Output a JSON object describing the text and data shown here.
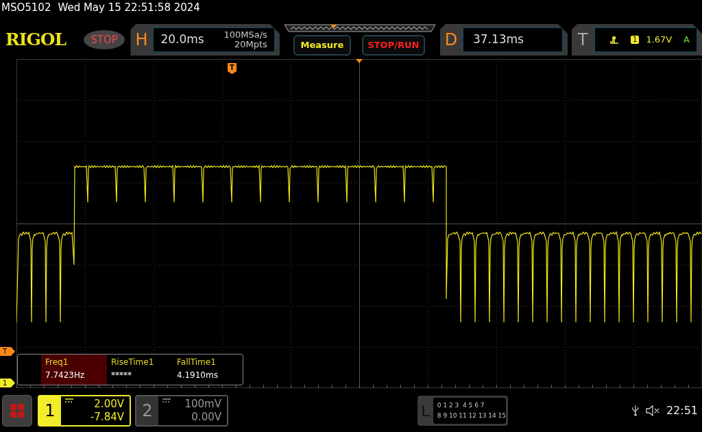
{
  "title_bar": {
    "model": "MSO5102",
    "datetime": "Wed May 15 22:51:58 2024"
  },
  "header": {
    "logo": "RIGOL",
    "run_state": "STOP",
    "horizontal": {
      "letter": "H",
      "timebase": "20.0ms",
      "sample_rate": "100MSa/s",
      "memory_depth": "20Mpts"
    },
    "menu_buttons": [
      {
        "label": "Measure",
        "kind": "menu"
      },
      {
        "label": "STOP/RUN",
        "kind": "run"
      }
    ],
    "delay": {
      "letter": "D",
      "value": "37.13ms"
    },
    "trigger": {
      "letter": "T",
      "source": "1",
      "level": "1.67V",
      "mode": "A"
    }
  },
  "graticule": {
    "top_marker": "T",
    "side_markers": [
      {
        "label": "T",
        "kind": "trigger"
      },
      {
        "label": "1",
        "kind": "channel"
      }
    ]
  },
  "measurements": [
    {
      "name": "Freq1",
      "value": "7.7423Hz",
      "selected": true
    },
    {
      "name": "RiseTime1",
      "value": "*****",
      "selected": false
    },
    {
      "name": "FallTime1",
      "value": "4.1910ms",
      "selected": false
    }
  ],
  "channels": [
    {
      "number": "1",
      "scale": "2.00V",
      "offset": "-7.84V",
      "on": true
    },
    {
      "number": "2",
      "scale": "100mV",
      "offset": "0.00V",
      "on": false
    }
  ],
  "logic": {
    "letter": "L",
    "row_1": "0 1 2 3  4 5 6 7",
    "row_2": "8 9 10 11 12 13 14 15"
  },
  "status": {
    "time": "22:51"
  }
}
